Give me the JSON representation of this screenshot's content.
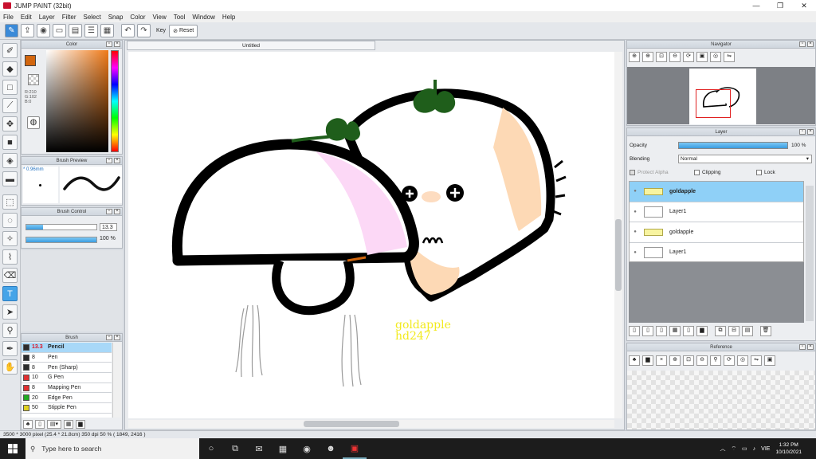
{
  "window": {
    "title": "JUMP PAINT (32bit)",
    "controls": [
      "—",
      "❐",
      "✕"
    ]
  },
  "menu": [
    "File",
    "Edit",
    "Layer",
    "Filter",
    "Select",
    "Snap",
    "Color",
    "View",
    "Tool",
    "Window",
    "Help"
  ],
  "toolbar": {
    "key_label": "Key",
    "reset_label": "Reset"
  },
  "panels": {
    "color": {
      "title": "Color",
      "main_color": "#d2660e",
      "rgb": [
        "R:210",
        "G:102",
        "B:0"
      ]
    },
    "brush_preview": {
      "title": "Brush Preview",
      "size": "* 0.96mm"
    },
    "brush_control": {
      "title": "Brush Control",
      "size_value": "13.3",
      "size_fraction": 0.24,
      "opacity_value": "100 %",
      "opacity_fraction": 1.0
    },
    "brush": {
      "title": "Brush",
      "items": [
        {
          "size": "13.3",
          "name": "Pencil",
          "color": "#2b2b2b",
          "selected": true
        },
        {
          "size": "8",
          "name": "Pen",
          "color": "#2b2b2b"
        },
        {
          "size": "8",
          "name": "Pen (Sharp)",
          "color": "#2b2b2b"
        },
        {
          "size": "10",
          "name": "G Pen",
          "color": "#e03030"
        },
        {
          "size": "8",
          "name": "Mapping Pen",
          "color": "#e03030"
        },
        {
          "size": "20",
          "name": "Edge Pen",
          "color": "#22aa22"
        },
        {
          "size": "50",
          "name": "Stipple Pen",
          "color": "#e0d020"
        }
      ]
    },
    "navigator": {
      "title": "Navigator"
    },
    "layer": {
      "title": "Layer",
      "opacity_label": "Opacity",
      "opacity_value": "100 %",
      "blending_label": "Blending",
      "blending_value": "Normal",
      "protect_alpha": "Protect Alpha",
      "clipping": "Clipping",
      "lock": "Lock",
      "layers": [
        {
          "name": "goldapple",
          "type": "folder",
          "selected": true
        },
        {
          "name": "Layer1",
          "type": "layer"
        },
        {
          "name": "goldapple",
          "type": "folder"
        },
        {
          "name": "Layer1",
          "type": "layer"
        }
      ]
    },
    "reference": {
      "title": "Reference"
    }
  },
  "canvas": {
    "tab_title": "Untitled",
    "watermark_line1": "goldapple",
    "watermark_line2": "hd247",
    "watermark_color": "#f2ea1e"
  },
  "status": {
    "text": "3500 * 3000 pixel  (25.4 * 21.8cm)  350 dpi  50 %  ( 1849, 2416 )"
  },
  "taskbar": {
    "search_placeholder": "Type here to search",
    "language": "VIE",
    "time": "1:32 PM",
    "date": "10/10/2021"
  }
}
